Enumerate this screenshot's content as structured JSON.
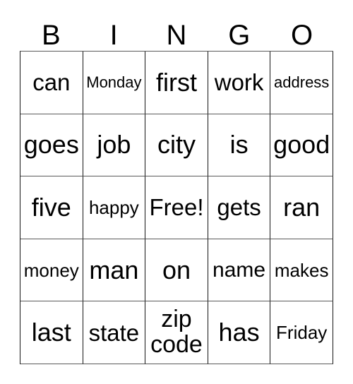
{
  "card": {
    "title": "BINGO",
    "headers": [
      "B",
      "I",
      "N",
      "G",
      "O"
    ],
    "free_space_label": "Free!",
    "rows": [
      [
        {
          "text": "can",
          "size": "lg"
        },
        {
          "text": "Monday",
          "size": "xs"
        },
        {
          "text": "first",
          "size": "xl"
        },
        {
          "text": "work",
          "size": "lg"
        },
        {
          "text": "address",
          "size": "xs"
        }
      ],
      [
        {
          "text": "goes",
          "size": "xl"
        },
        {
          "text": "job",
          "size": "xl"
        },
        {
          "text": "city",
          "size": "xl"
        },
        {
          "text": "is",
          "size": "xl"
        },
        {
          "text": "good",
          "size": "xl"
        }
      ],
      [
        {
          "text": "five",
          "size": "xl"
        },
        {
          "text": "happy",
          "size": "sm"
        },
        {
          "text": "Free!",
          "size": "lg"
        },
        {
          "text": "gets",
          "size": "lg"
        },
        {
          "text": "ran",
          "size": "xl"
        }
      ],
      [
        {
          "text": "money",
          "size": "sm"
        },
        {
          "text": "man",
          "size": "xl"
        },
        {
          "text": "on",
          "size": "xl"
        },
        {
          "text": "name",
          "size": "md"
        },
        {
          "text": "makes",
          "size": "sm"
        }
      ],
      [
        {
          "text": "last",
          "size": "xl"
        },
        {
          "text": "state",
          "size": "lg"
        },
        {
          "text": "zip\ncode",
          "size": "wrap"
        },
        {
          "text": "has",
          "size": "xl"
        },
        {
          "text": "Friday",
          "size": "sm"
        }
      ]
    ]
  },
  "colors": {
    "background": "#ffffff",
    "text": "#000000",
    "border_dark": "#151515",
    "border_light": "#595959"
  }
}
